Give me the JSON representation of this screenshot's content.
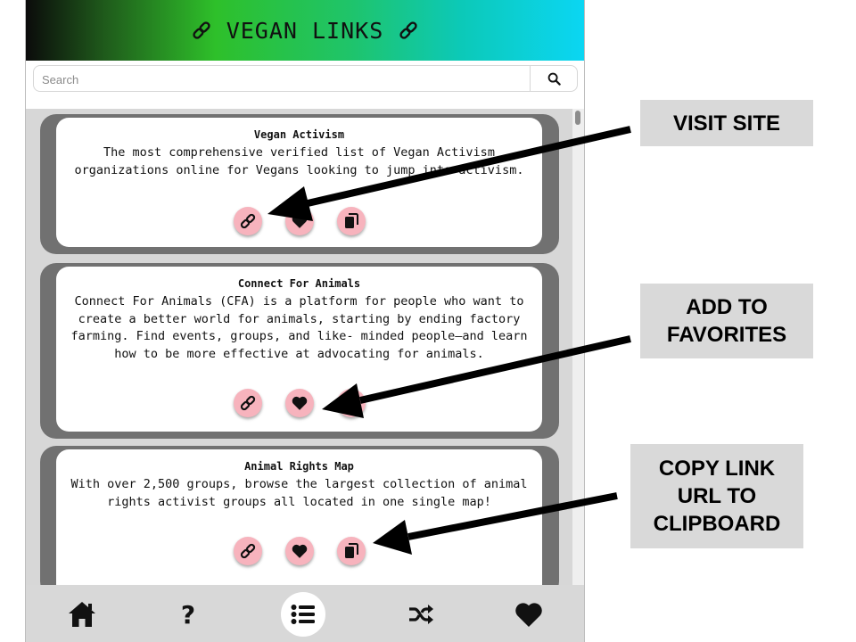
{
  "header": {
    "title": "VEGAN LINKS"
  },
  "search": {
    "placeholder": "Search",
    "value": ""
  },
  "cards": [
    {
      "title": "Vegan Activism",
      "description": "The most comprehensive verified list of Vegan Activism organizations online for Vegans looking to jump into activism."
    },
    {
      "title": "Connect For Animals",
      "description": "Connect For Animals (CFA) is a platform for people who want to create a better world for animals, starting by ending factory farming. Find events, groups, and like- minded people—and learn how to be more effective at advocating for animals."
    },
    {
      "title": "Animal Rights Map",
      "description": "With over 2,500 groups, browse the largest collection of animal rights activist groups all located in one single map!"
    }
  ],
  "card_actions": [
    "link-icon",
    "heart-icon",
    "copy-icon"
  ],
  "nav": {
    "items": [
      "home-icon",
      "question-icon",
      "list-icon",
      "shuffle-icon",
      "heart-icon"
    ],
    "active": "list-icon",
    "help_glyph": "?"
  },
  "callouts": {
    "visit": "VISIT SITE",
    "favorites_line1": "ADD TO",
    "favorites_line2": "FAVORITES",
    "copy_line1": "COPY LINK",
    "copy_line2": "URL TO",
    "copy_line3": "CLIPBOARD"
  },
  "colors": {
    "action_button": "#f7b3bd",
    "card_shadow": "#717171",
    "list_background": "#d7d7d7",
    "nav_background": "#d8d8d8",
    "callout_background": "#d9d9d9"
  }
}
